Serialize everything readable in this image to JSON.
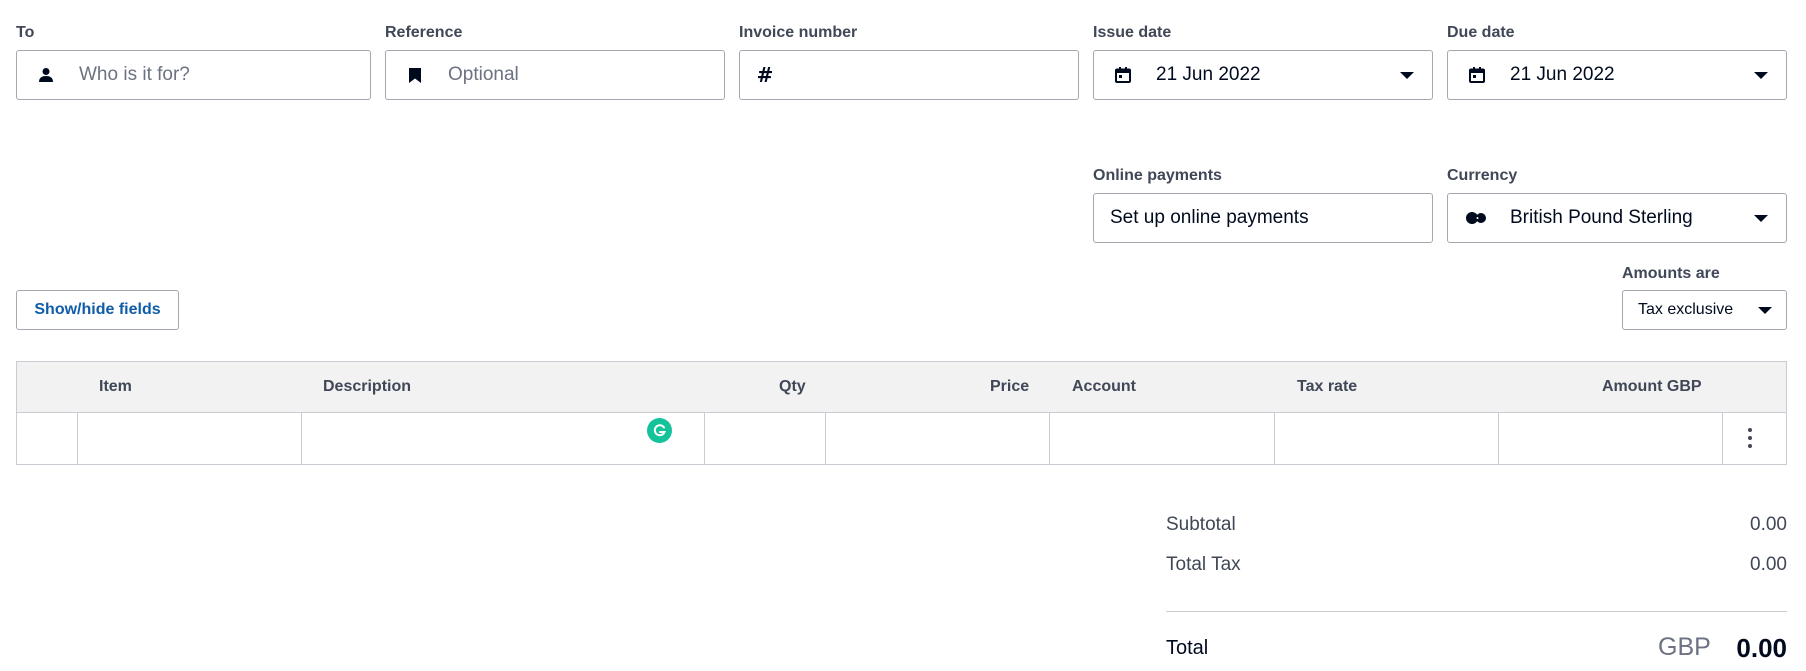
{
  "header_fields": {
    "to": {
      "label": "To",
      "placeholder": "Who is it for?"
    },
    "reference": {
      "label": "Reference",
      "placeholder": "Optional"
    },
    "invoice_number": {
      "label": "Invoice number",
      "value": ""
    },
    "issue_date": {
      "label": "Issue date",
      "value": "21 Jun 2022"
    },
    "due_date": {
      "label": "Due date",
      "value": "21 Jun 2022"
    },
    "online_payments": {
      "label": "Online payments",
      "link": "Set up online payments"
    },
    "currency": {
      "label": "Currency",
      "value": "British Pound Sterling"
    }
  },
  "toolbar": {
    "show_hide_label": "Show/hide fields",
    "amounts_label": "Amounts are",
    "amounts_value": "Tax exclusive"
  },
  "table": {
    "columns": [
      "Item",
      "Description",
      "Qty",
      "Price",
      "Account",
      "Tax rate",
      "Amount GBP"
    ],
    "rows": [
      {
        "item": "",
        "description": "",
        "qty": "",
        "price": "",
        "account": "",
        "tax_rate": "",
        "amount": ""
      }
    ]
  },
  "totals": {
    "subtotal_label": "Subtotal",
    "subtotal_value": "0.00",
    "tax_label": "Total Tax",
    "tax_value": "0.00",
    "total_label": "Total",
    "total_currency": "GBP",
    "total_value": "0.00"
  },
  "icons": {
    "to": "person-icon",
    "reference": "bookmark-icon",
    "invoice_number": "hash-icon",
    "issue_date": "calendar-icon",
    "due_date": "calendar-icon",
    "currency": "currency-icon",
    "grammarly": "grammarly-icon",
    "row_menu": "more-vertical-icon"
  },
  "colors": {
    "link": "#0078c8",
    "button_text": "#0f5da8",
    "grammarly": "#15c39a",
    "header_bg": "#f2f2f3"
  }
}
